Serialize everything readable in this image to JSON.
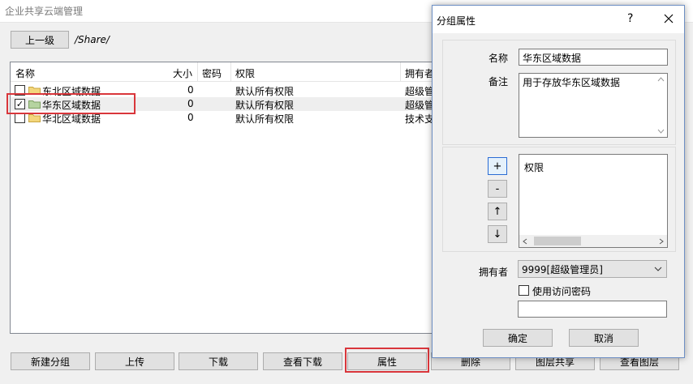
{
  "window": {
    "title": "企业共享云端管理",
    "up_button": "上一级",
    "path": "/Share/"
  },
  "list": {
    "columns": [
      "名称",
      "大小",
      "密码",
      "权限",
      "拥有者"
    ],
    "rows": [
      {
        "checked": false,
        "name": "东北区域数据",
        "size": "0",
        "password": "",
        "permission": "默认所有权限",
        "owner": "超级管"
      },
      {
        "checked": true,
        "name": "华东区域数据",
        "size": "0",
        "password": "",
        "permission": "默认所有权限",
        "owner": "超级管"
      },
      {
        "checked": false,
        "name": "华北区域数据",
        "size": "0",
        "password": "",
        "permission": "默认所有权限",
        "owner": "技术支"
      }
    ],
    "checkmark": "✓"
  },
  "toolbar": {
    "new_group": "新建分组",
    "upload": "上传",
    "download": "下载",
    "view_downloads": "查看下载",
    "properties": "属性",
    "delete": "删除",
    "layer_share": "图层共享",
    "view_layers": "查看图层"
  },
  "dialog": {
    "title": "分组属性",
    "help": "?",
    "name_label": "名称",
    "name_value": "华东区域数据",
    "note_label": "备注",
    "note_value": "用于存放华东区域数据",
    "perm_buttons": [
      "+",
      "-",
      "↑",
      "↓"
    ],
    "perm_list_header": "权限",
    "owner_label": "拥有者",
    "owner_value": "9999[超级管理员]",
    "use_password_label": "使用访问密码",
    "password_value": "",
    "ok": "确定",
    "cancel": "取消"
  },
  "colors": {
    "highlight": "#d9363b",
    "folder": "#f3d67c",
    "folder_selected": "#b5d3a0",
    "dialog_border": "#6d8fc4"
  }
}
